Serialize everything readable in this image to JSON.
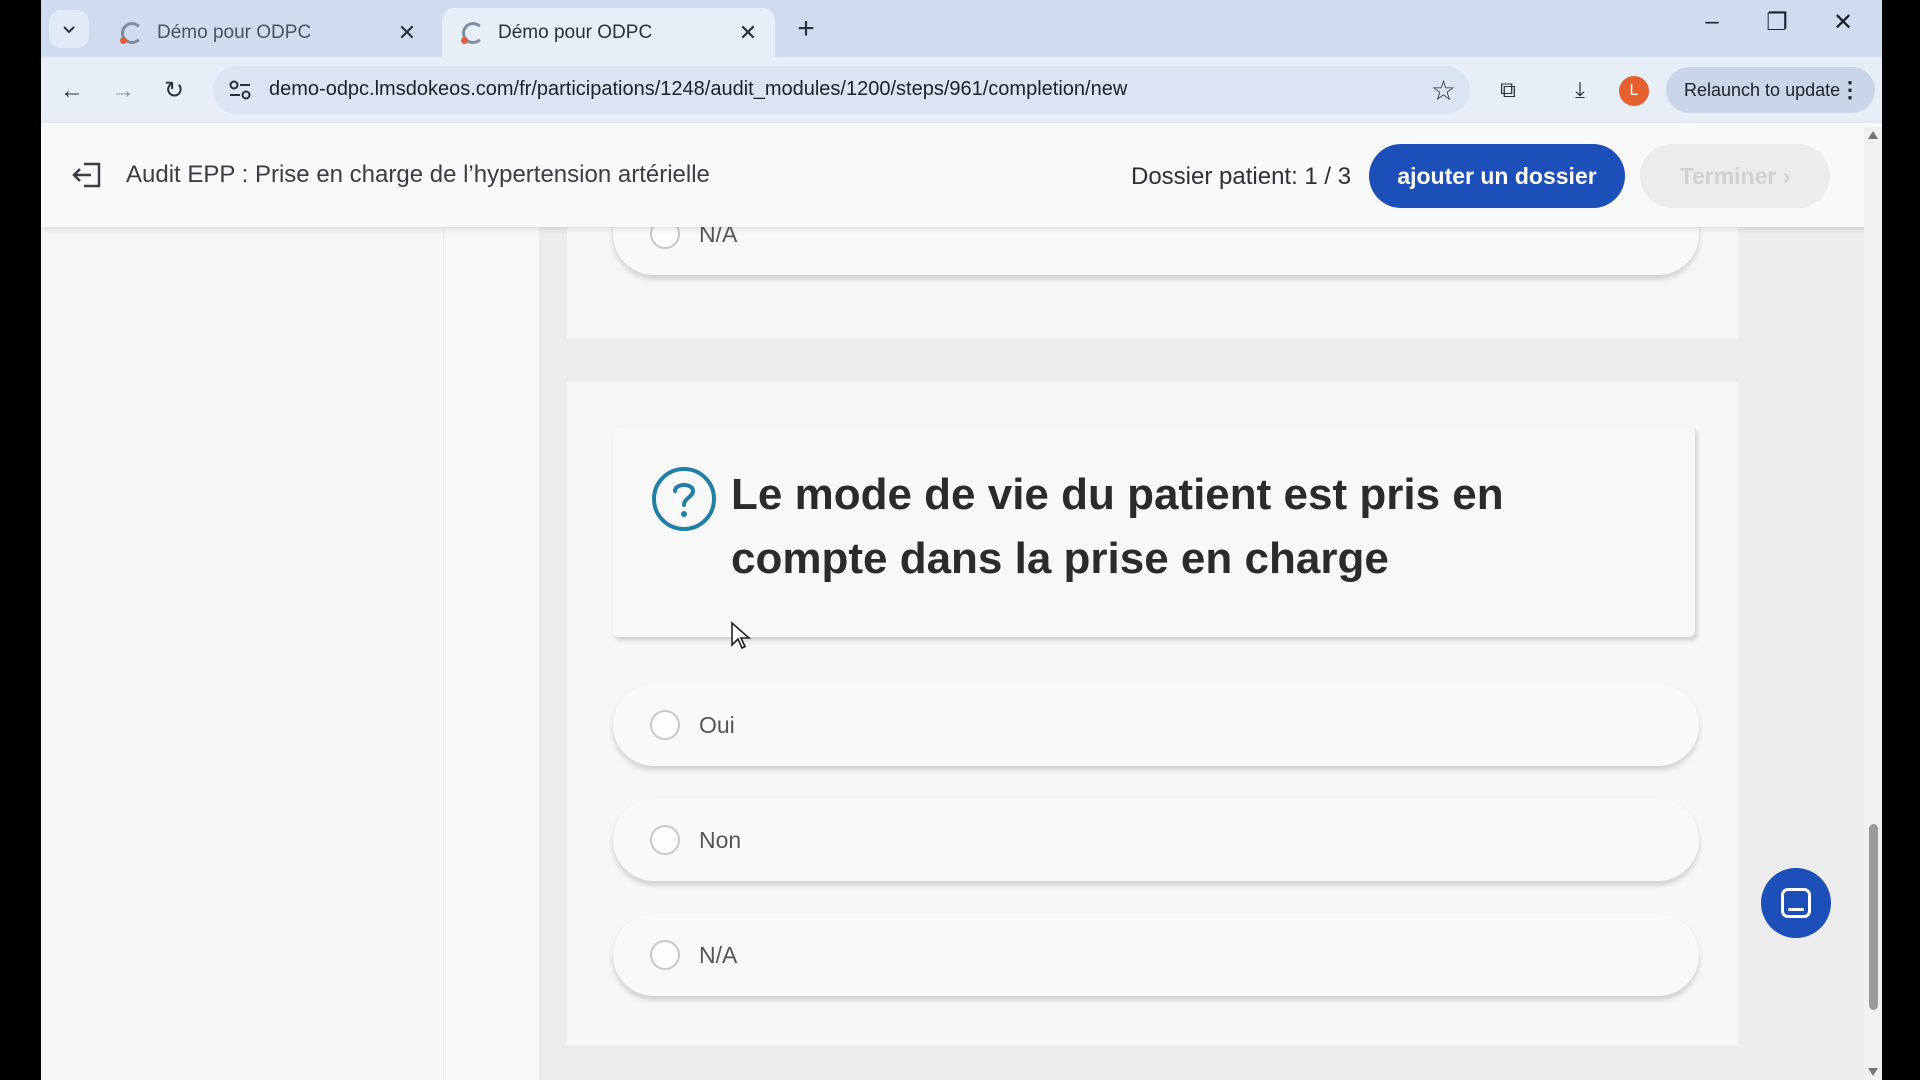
{
  "browser": {
    "tabs": [
      {
        "title": "Démo pour ODPC",
        "active": false
      },
      {
        "title": "Démo pour ODPC",
        "active": true
      }
    ],
    "url": "demo-odpc.lmsdokeos.com/fr/participations/1248/audit_modules/1200/steps/961/completion/new",
    "profile_initial": "L",
    "relaunch_label": "Relaunch to update",
    "colors": {
      "profile": "#e5602f",
      "tabstrip": "#cfdcef"
    }
  },
  "header": {
    "title": "Audit EPP : Prise en charge de l’hypertension artérielle",
    "dossier_label": "Dossier patient: 1 / 3",
    "add_button": "ajouter un dossier",
    "finish_button": "Terminer",
    "finish_chevron": "›",
    "colors": {
      "primary": "#1c4fb8"
    }
  },
  "previous_question": {
    "options": [
      {
        "label": "N/A",
        "selected": false
      }
    ]
  },
  "question": {
    "icon": "question-circle-icon",
    "text": "Le mode de vie du patient est pris en compte dans la prise en charge",
    "options": [
      {
        "label": "Oui",
        "selected": false
      },
      {
        "label": "Non",
        "selected": false
      },
      {
        "label": "N/A",
        "selected": false
      }
    ]
  },
  "chat_widget": {
    "icon": "chat-icon"
  }
}
